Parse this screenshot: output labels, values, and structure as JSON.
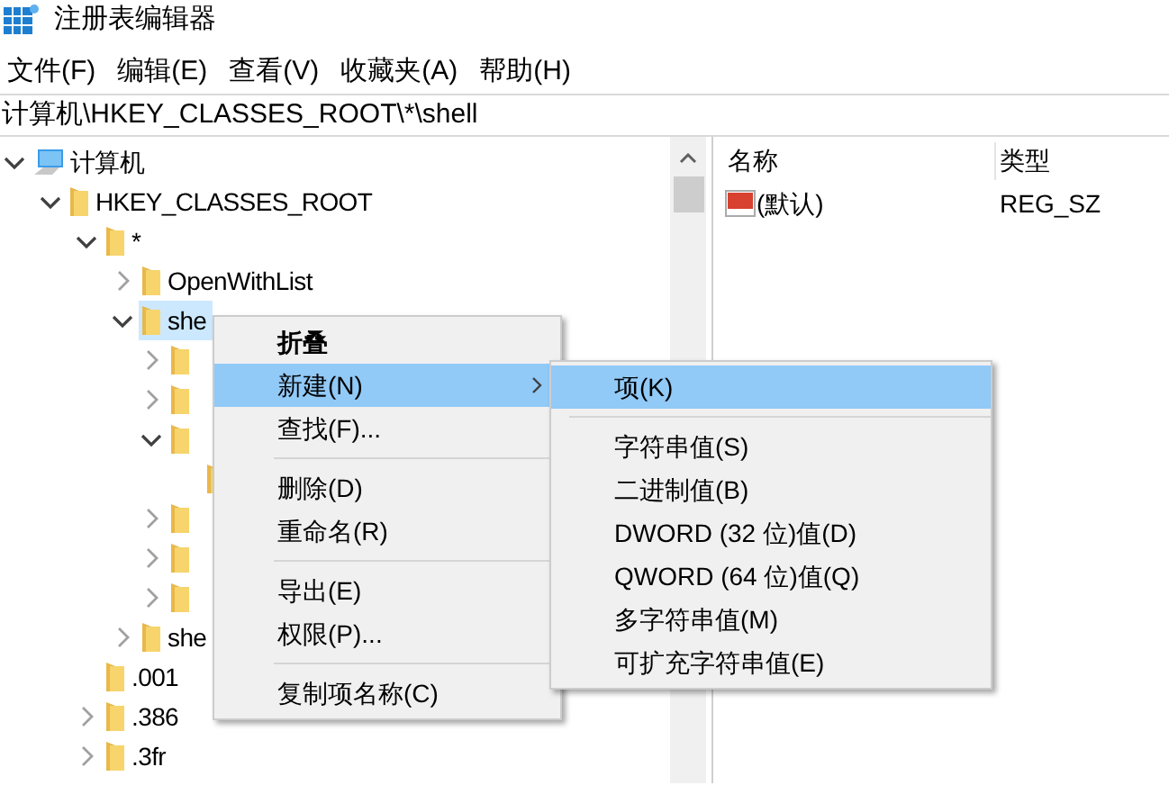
{
  "window": {
    "title": "注册表编辑器"
  },
  "menu_bar": [
    "文件(F)",
    "编辑(E)",
    "查看(V)",
    "收藏夹(A)",
    "帮助(H)"
  ],
  "address": "计算机\\HKEY_CLASSES_ROOT\\*\\shell",
  "tree": [
    {
      "label": "计算机",
      "kind": "computer",
      "expandable": true,
      "expanded": true,
      "selected": false,
      "children": [
        {
          "label": "HKEY_CLASSES_ROOT",
          "kind": "folder",
          "expandable": true,
          "expanded": true,
          "selected": false,
          "children": [
            {
              "label": "*",
              "kind": "folder",
              "expandable": true,
              "expanded": true,
              "selected": false,
              "children": [
                {
                  "label": "OpenWithList",
                  "kind": "folder",
                  "expandable": true,
                  "expanded": false,
                  "selected": false
                },
                {
                  "label": "she",
                  "kind": "folder",
                  "expandable": true,
                  "expanded": true,
                  "selected": true,
                  "children": [
                    {
                      "kind": "folder",
                      "expandable": true,
                      "expanded": false,
                      "selected": false
                    },
                    {
                      "kind": "folder",
                      "expandable": true,
                      "expanded": false,
                      "selected": false
                    },
                    {
                      "kind": "folder",
                      "expandable": true,
                      "expanded": true,
                      "selected": false,
                      "children": [
                        {
                          "kind": "folder",
                          "expandable": false,
                          "expanded": false,
                          "selected": false
                        }
                      ]
                    },
                    {
                      "kind": "folder",
                      "expandable": true,
                      "expanded": false,
                      "selected": false
                    },
                    {
                      "kind": "folder",
                      "expandable": true,
                      "expanded": false,
                      "selected": false
                    },
                    {
                      "kind": "folder",
                      "expandable": true,
                      "expanded": false,
                      "selected": false
                    }
                  ]
                },
                {
                  "label": "she",
                  "kind": "folder",
                  "expandable": true,
                  "expanded": false,
                  "selected": false
                }
              ]
            },
            {
              "label": ".001",
              "kind": "folder",
              "expandable": false,
              "expanded": false,
              "selected": false
            },
            {
              "label": ".386",
              "kind": "folder",
              "expandable": true,
              "expanded": false,
              "selected": false
            },
            {
              "label": ".3fr",
              "kind": "folder",
              "expandable": true,
              "expanded": false,
              "selected": false
            }
          ]
        }
      ]
    }
  ],
  "values": {
    "columns": [
      "名称",
      "类型"
    ],
    "rows": [
      {
        "name": "(默认)",
        "type": "REG_SZ"
      }
    ]
  },
  "context_menu": [
    {
      "kind": "item",
      "label": "折叠",
      "default": true,
      "selected": false,
      "submenu": false
    },
    {
      "kind": "item",
      "label": "新建(N)",
      "default": false,
      "selected": true,
      "submenu": true
    },
    {
      "kind": "item",
      "label": "查找(F)...",
      "default": false,
      "selected": false,
      "submenu": false
    },
    {
      "kind": "separator"
    },
    {
      "kind": "item",
      "label": "删除(D)",
      "default": false,
      "selected": false,
      "submenu": false
    },
    {
      "kind": "item",
      "label": "重命名(R)",
      "default": false,
      "selected": false,
      "submenu": false
    },
    {
      "kind": "separator"
    },
    {
      "kind": "item",
      "label": "导出(E)",
      "default": false,
      "selected": false,
      "submenu": false
    },
    {
      "kind": "item",
      "label": "权限(P)...",
      "default": false,
      "selected": false,
      "submenu": false
    },
    {
      "kind": "separator"
    },
    {
      "kind": "item",
      "label": "复制项名称(C)",
      "default": false,
      "selected": false,
      "submenu": false
    }
  ],
  "submenu": [
    {
      "kind": "item",
      "label": "项(K)",
      "selected": true
    },
    {
      "kind": "separator"
    },
    {
      "kind": "item",
      "label": "字符串值(S)",
      "selected": false
    },
    {
      "kind": "item",
      "label": "二进制值(B)",
      "selected": false
    },
    {
      "kind": "item",
      "label": "DWORD (32 位)值(D)",
      "selected": false
    },
    {
      "kind": "item",
      "label": "QWORD (64 位)值(Q)",
      "selected": false
    },
    {
      "kind": "item",
      "label": "多字符串值(M)",
      "selected": false
    },
    {
      "kind": "item",
      "label": "可扩充字符串值(E)",
      "selected": false
    }
  ]
}
